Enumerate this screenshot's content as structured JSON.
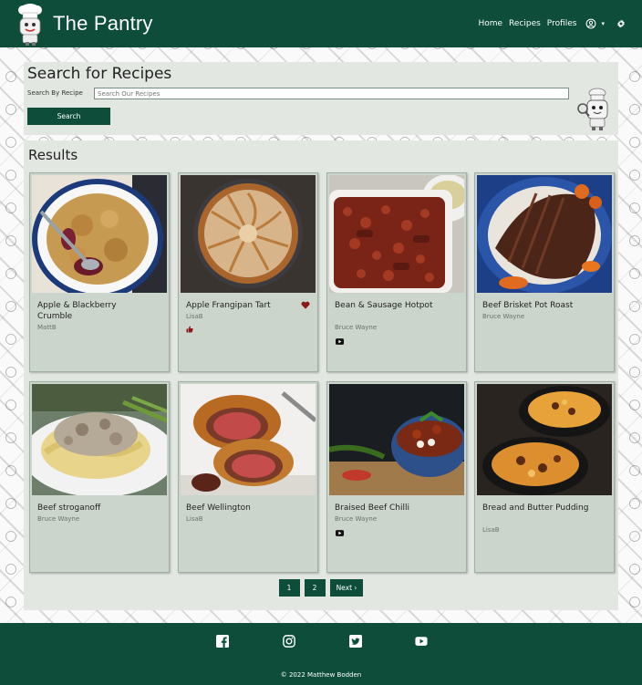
{
  "app": {
    "brand": "The Pantry"
  },
  "nav": {
    "home": "Home",
    "recipes": "Recipes",
    "profiles": "Profiles",
    "user_icon": "user-circle-icon",
    "settings_icon": "gear-icon"
  },
  "search": {
    "title": "Search for Recipes",
    "label": "Search By Recipe",
    "placeholder": "Search Our Recipes",
    "value": "",
    "button": "Search"
  },
  "results": {
    "title": "Results",
    "cards": [
      {
        "title": "Apple & Blackberry Crumble",
        "author": "MattB",
        "favourite": false,
        "liked": false,
        "video": false
      },
      {
        "title": "Apple Frangipan Tart",
        "author": "LisaB",
        "favourite": true,
        "liked": true,
        "video": false
      },
      {
        "title": "Bean & Sausage Hotpot",
        "author": "Bruce Wayne",
        "favourite": false,
        "liked": false,
        "video": true
      },
      {
        "title": "Beef Brisket Pot Roast",
        "author": "Bruce Wayne",
        "favourite": false,
        "liked": false,
        "video": false
      },
      {
        "title": "Beef stroganoff",
        "author": "Bruce Wayne",
        "favourite": false,
        "liked": false,
        "video": false
      },
      {
        "title": "Beef Wellington",
        "author": "LisaB",
        "favourite": false,
        "liked": false,
        "video": false
      },
      {
        "title": "Braised Beef Chilli",
        "author": "Bruce Wayne",
        "favourite": false,
        "liked": false,
        "video": true
      },
      {
        "title": "Bread and Butter Pudding",
        "author": "LisaB",
        "favourite": false,
        "liked": false,
        "video": false
      }
    ]
  },
  "pagination": {
    "page1": "1",
    "page2": "2",
    "next": "Next ›"
  },
  "footer": {
    "icons": [
      "facebook-icon",
      "instagram-icon",
      "twitter-icon",
      "youtube-icon"
    ],
    "copyright": "© 2022 Matthew Bodden"
  },
  "colors": {
    "primary": "#0d4d3a",
    "panel": "#e3e7e2",
    "card": "#cbd5cb",
    "favourite": "#8b1a1a"
  }
}
